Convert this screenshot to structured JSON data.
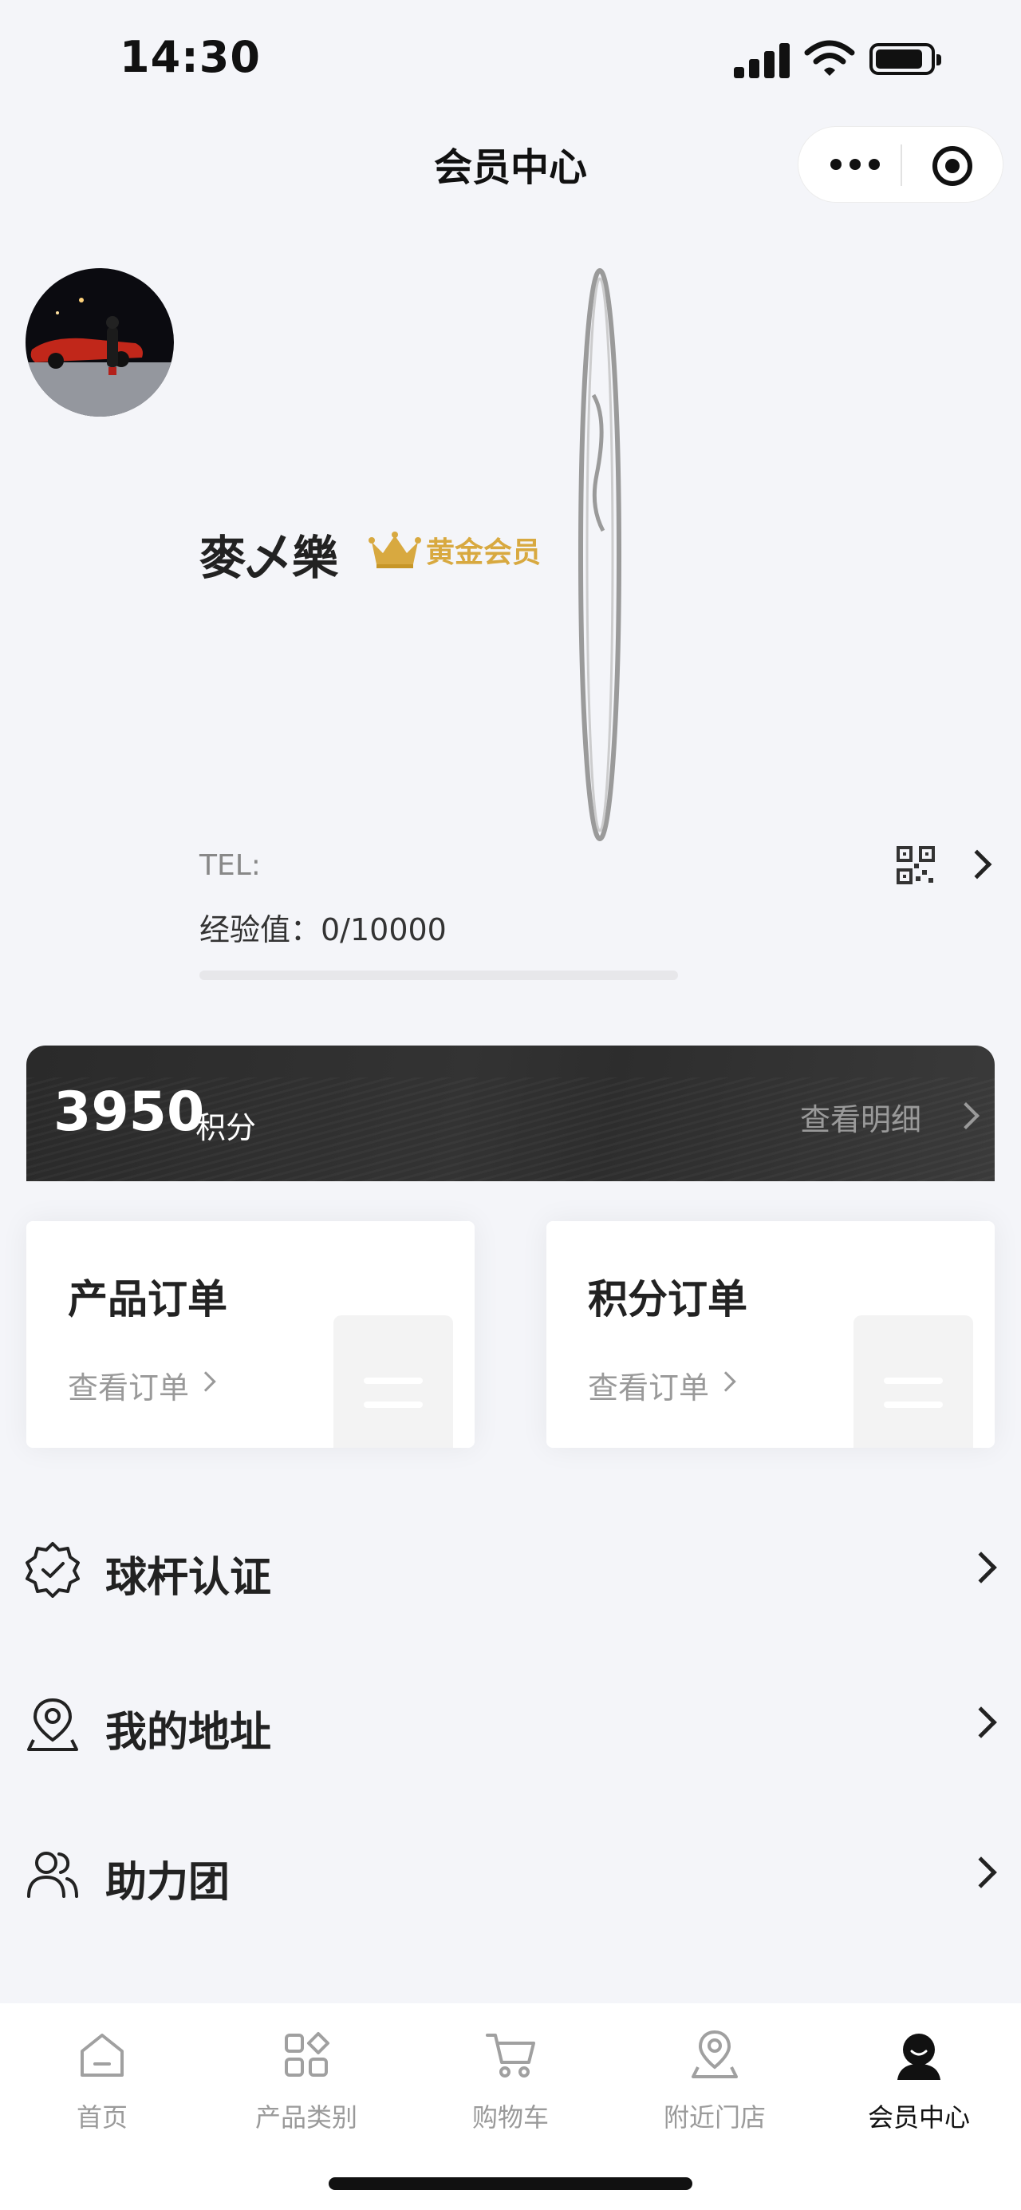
{
  "status_bar": {
    "time": "14:30"
  },
  "nav": {
    "title": "会员中心"
  },
  "profile": {
    "name": "麥乄樂",
    "badge": "黄金会员",
    "tel_label": "TEL:",
    "exp_text": "经验值：0/10000",
    "exp_progress": 0
  },
  "points": {
    "value": "3950",
    "unit": "积分",
    "detail_label": "查看明细"
  },
  "orders": [
    {
      "title": "产品订单",
      "link": "查看订单"
    },
    {
      "title": "积分订单",
      "link": "查看订单"
    }
  ],
  "menu": [
    {
      "label": "球杆认证",
      "icon": "verified-badge-icon"
    },
    {
      "label": "我的地址",
      "icon": "location-pin-icon"
    },
    {
      "label": "助力团",
      "icon": "users-icon"
    }
  ],
  "tabs": [
    {
      "label": "首页",
      "icon": "home-icon"
    },
    {
      "label": "产品类别",
      "icon": "category-grid-icon"
    },
    {
      "label": "购物车",
      "icon": "cart-icon"
    },
    {
      "label": "附近门店",
      "icon": "store-location-icon"
    },
    {
      "label": "会员中心",
      "icon": "member-icon",
      "active": true
    }
  ],
  "colors": {
    "gold": "#d8a940",
    "dark_card": "#2e2e2e",
    "background": "#f4f5f9"
  }
}
